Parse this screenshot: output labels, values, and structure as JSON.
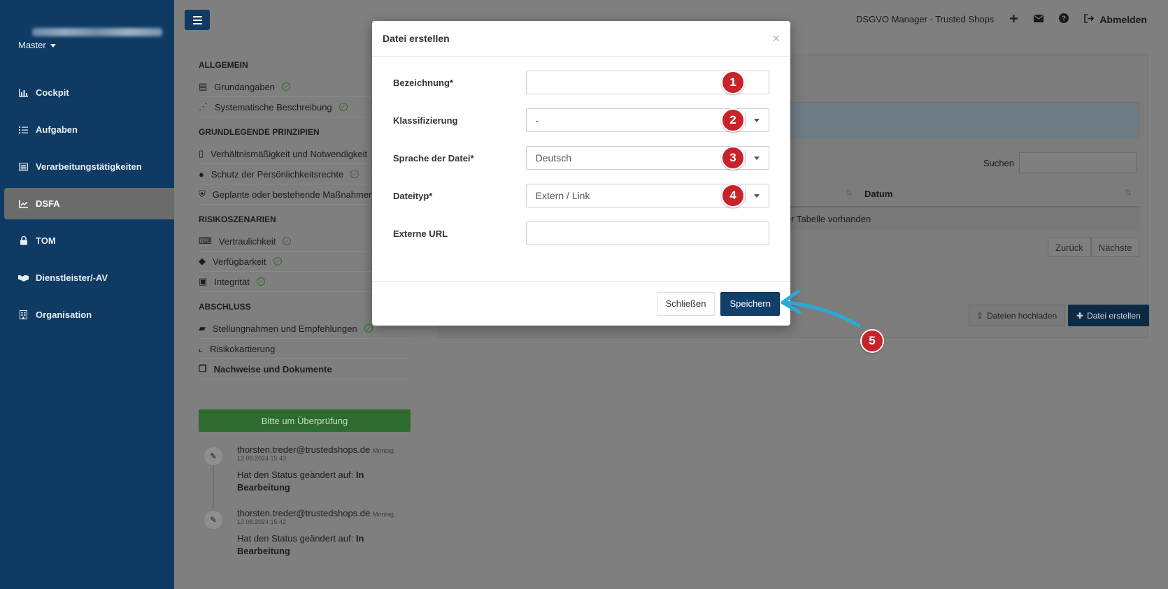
{
  "sidebar": {
    "org_selector": "Master",
    "items": [
      {
        "label": "Cockpit",
        "icon": "bar-chart-icon"
      },
      {
        "label": "Aufgaben",
        "icon": "tasks-icon"
      },
      {
        "label": "Verarbeitungstätigkeiten",
        "icon": "list-icon"
      },
      {
        "label": "DSFA",
        "icon": "line-chart-icon",
        "active": true
      },
      {
        "label": "TOM",
        "icon": "lock-icon"
      },
      {
        "label": "Dienstleister/-AV",
        "icon": "handshake-icon"
      },
      {
        "label": "Organisation",
        "icon": "building-icon"
      }
    ]
  },
  "topbar": {
    "app_name": "DSGVO Manager - Trusted Shops",
    "logout_label": "Abmelden"
  },
  "sections": [
    {
      "title": "ALLGEMEIN",
      "items": [
        {
          "label": "Grundangaben",
          "icon": "list-icon",
          "checked": true
        },
        {
          "label": "Systematische Beschreibung",
          "icon": "share-icon",
          "checked": true
        }
      ]
    },
    {
      "title": "GRUNDLEGENDE PRINZIPIEN",
      "items": [
        {
          "label": "Verhältnismäßigkeit und Notwendigkeit",
          "icon": "file-icon",
          "checked": false
        },
        {
          "label": "Schutz der Persönlichkeitsrechte",
          "icon": "user-shield-icon",
          "checked": true
        },
        {
          "label": "Geplante oder bestehende Maßnahmen",
          "icon": "shield-icon",
          "checked": false
        }
      ]
    },
    {
      "title": "RISIKOSZENARIEN",
      "items": [
        {
          "label": "Vertraulichkeit",
          "icon": "keyboard-icon",
          "checked": true
        },
        {
          "label": "Verfügbarkeit",
          "icon": "eraser-icon",
          "checked": true
        },
        {
          "label": "Integrität",
          "icon": "save-icon",
          "checked": true
        }
      ]
    },
    {
      "title": "ABSCHLUSS",
      "items": [
        {
          "label": "Stellungnahmen und Empfehlungen",
          "icon": "comments-icon",
          "checked": true
        },
        {
          "label": "Risikokartierung",
          "icon": "chart-icon",
          "checked": false
        },
        {
          "label": "Nachweise und Dokumente",
          "icon": "copy-icon",
          "checked": false,
          "bold": true
        }
      ]
    }
  ],
  "review_button": "Bitte um Überprüfung",
  "timeline": [
    {
      "email": "thorsten.treder@trustedshops.de",
      "date_line1": "Montag,",
      "date_line2": "12.08.2024 15:43",
      "message": "Hat den Status geändert auf:",
      "status_line1": "In",
      "status_line2": "Bearbeitung"
    },
    {
      "email": "thorsten.treder@trustedshops.de",
      "date_line1": "Montag,",
      "date_line2": "12.08.2024 15:42",
      "message": "Hat den Status geändert auf:",
      "status_line1": "In",
      "status_line2": "Bearbeitung"
    }
  ],
  "files_panel": {
    "search_label": "Suchen",
    "col_datum": "Datum",
    "empty_text": "er Tabelle vorhanden",
    "prev_label": "Zurück",
    "next_label": "Nächste",
    "upload_label": "Dateien hochladen",
    "create_label": "Datei erstellen"
  },
  "modal": {
    "title": "Datei erstellen",
    "close_glyph": "×",
    "fields": {
      "bezeichnung": {
        "label": "Bezeichnung*",
        "value": ""
      },
      "klassifizierung": {
        "label": "Klassifizierung",
        "value": "-"
      },
      "sprache": {
        "label": "Sprache der Datei*",
        "value": "Deutsch"
      },
      "dateityp": {
        "label": "Dateityp*",
        "value": "Extern / Link"
      },
      "url": {
        "label": "Externe URL",
        "value": ""
      }
    },
    "close_button": "Schließen",
    "save_button": "Speichern"
  },
  "badges": [
    "1",
    "2",
    "3",
    "4",
    "5"
  ],
  "colors": {
    "sidebar": "#0f3a63",
    "primary": "#123f6a",
    "badge": "#c8222b",
    "arrow": "#29a9d8",
    "success": "#2f6b2f"
  }
}
